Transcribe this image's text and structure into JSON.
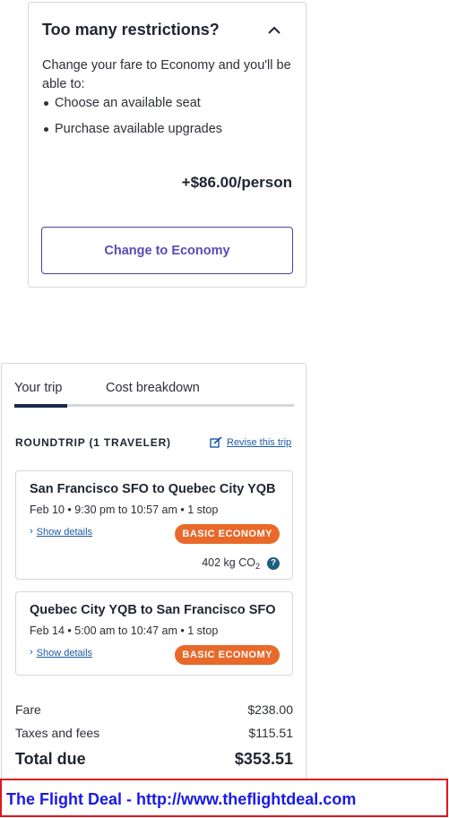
{
  "upsell": {
    "title": "Too many restrictions?",
    "description": "Change your fare to Economy and you'll be able to:",
    "benefits": [
      "Choose an available seat",
      "Purchase available upgrades"
    ],
    "price": "+$86.00/person",
    "button_label": "Change to Economy",
    "icon": "chevron-up-icon"
  },
  "trip": {
    "tabs": [
      {
        "label": "Your trip",
        "active": true
      },
      {
        "label": "Cost breakdown",
        "active": false
      }
    ],
    "heading": "ROUNDTRIP (1 TRAVELER)",
    "revise_label": "Revise this trip",
    "segments": [
      {
        "route": "San Francisco SFO to Quebec City YQB",
        "times": "Feb 10 • 9:30 pm to 10:57 am • 1 stop",
        "details_label": "Show details",
        "badge": "BASIC ECONOMY",
        "co2_value": "402 kg CO",
        "co2_sub": "2",
        "help": "?"
      },
      {
        "route": "Quebec City YQB to San Francisco SFO",
        "times": "Feb 14 • 5:00 am to 10:47 am • 1 stop",
        "details_label": "Show details",
        "badge": "BASIC ECONOMY"
      }
    ],
    "costs": {
      "fare_label": "Fare",
      "fare_value": "$238.00",
      "taxes_label": "Taxes and fees",
      "taxes_value": "$115.51",
      "total_label": "Total due",
      "total_value": "$353.51"
    }
  },
  "banner": {
    "text": "The Flight Deal - http://www.theflightdeal.com"
  },
  "colors": {
    "accent_purple": "#5b49b5",
    "badge_orange": "#e8692a",
    "link_blue": "#1c5aa6",
    "tab_active": "#1b2a4a",
    "banner_red": "#e0161f",
    "banner_text": "#1a1ae6"
  }
}
